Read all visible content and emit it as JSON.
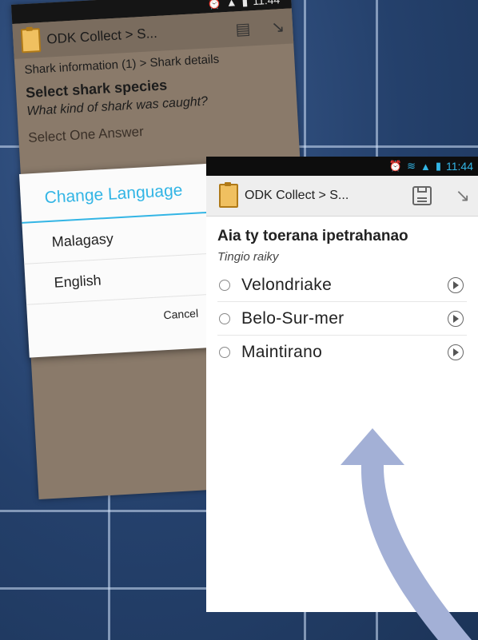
{
  "back_screen": {
    "status_time": "11:44",
    "app_title": "ODK Collect > S...",
    "breadcrumb": "Shark information (1) > Shark details",
    "question": "Select shark species",
    "hint": "What kind of shark was caught?",
    "select_prompt": "Select One Answer"
  },
  "dialog": {
    "title": "Change Language",
    "options": [
      "Malagasy",
      "English"
    ],
    "cancel_label": "Cancel"
  },
  "front_screen": {
    "status_time": "11:44",
    "app_title": "ODK Collect > S...",
    "question": "Aia ty toerana ipetrahanao",
    "hint": "Tingio raiky",
    "options": [
      "Velondriake",
      "Belo-Sur-mer",
      "Maintirano"
    ]
  },
  "colors": {
    "accent": "#33b5e5",
    "arrow": "#a3b0d6",
    "backdrop": "#2d4670"
  }
}
